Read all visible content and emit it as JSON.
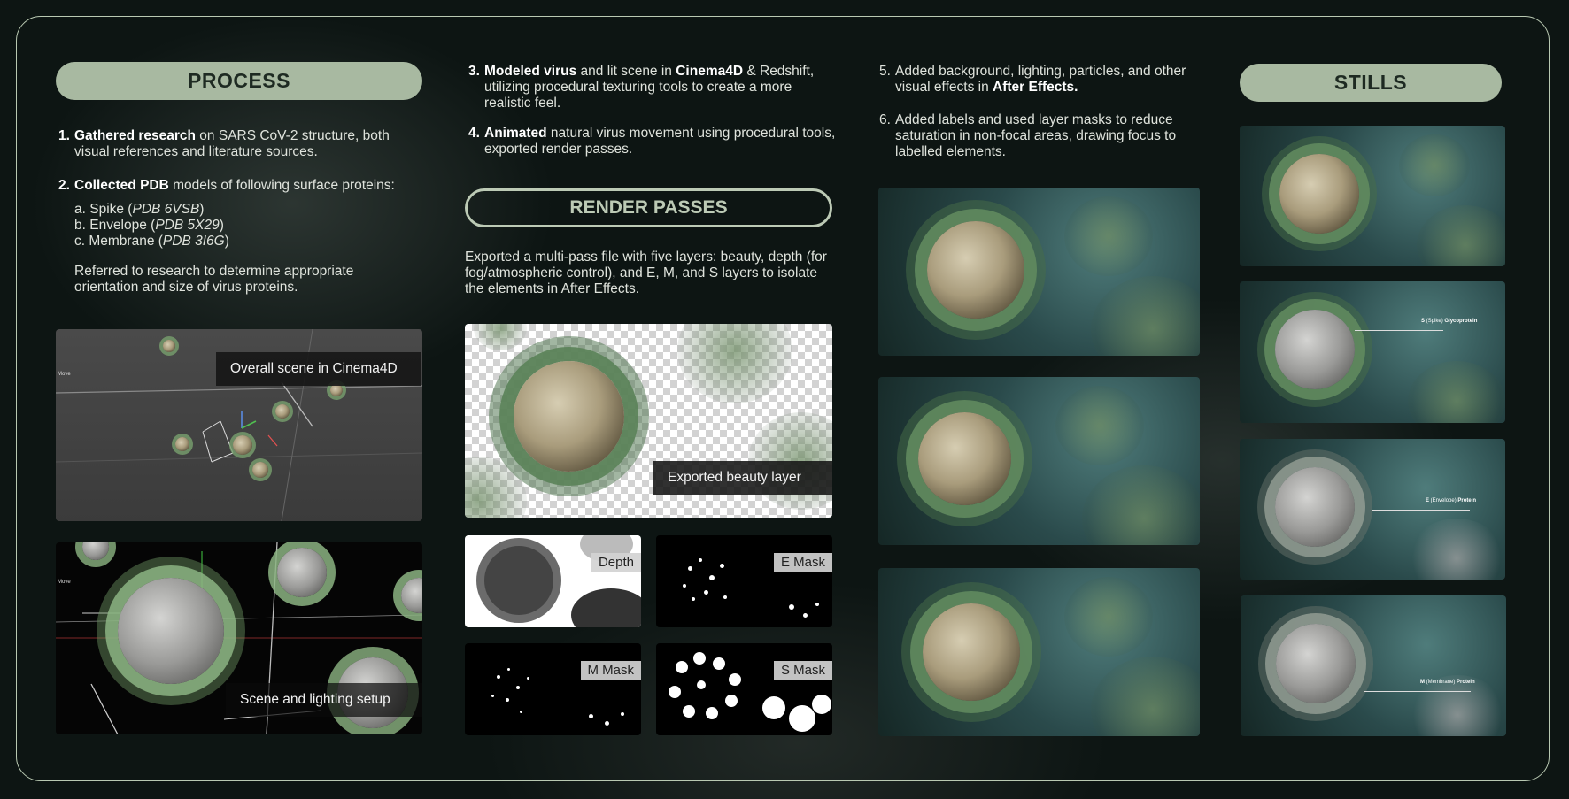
{
  "process": {
    "title": "PROCESS",
    "step1": {
      "num": "1.",
      "bold": "Gathered research",
      "text": " on SARS CoV-2 structure, both visual references and literature sources."
    },
    "step2": {
      "num": "2.",
      "bold": "Collected PDB",
      "text": " models of following surface proteins:"
    },
    "proteins": [
      {
        "prefix": "a. Spike (",
        "code": "PDB 6VSB",
        "suffix": ")"
      },
      {
        "prefix": "b. Envelope (",
        "code": "PDB 5X29",
        "suffix": ")"
      },
      {
        "prefix": "c. Membrane (",
        "code": "PDB 3I6G",
        "suffix": ")"
      }
    ],
    "note": "Referred to research to determine appropriate orientation and size of virus proteins.",
    "caption_scene": "Overall scene in Cinema4D",
    "caption_lighting": "Scene and lighting setup",
    "move_label": "Move"
  },
  "steps_mid": {
    "step3": {
      "num": "3.",
      "bold": "Modeled virus",
      "t1": " and lit scene in ",
      "bold2": "Cinema4D",
      "t2": " & Redshift, utilizing procedural texturing tools to create a more realistic feel."
    },
    "step4": {
      "num": "4.",
      "bold": "Animated",
      "text": " natural virus movement using procedural tools, exported render passes."
    }
  },
  "render_passes": {
    "title": "RENDER PASSES",
    "desc": "Exported a multi-pass file with five layers: beauty, depth (for fog/atmospheric control), and E, M, and S layers to isolate the elements in After Effects.",
    "caption_beauty": "Exported beauty layer",
    "labels": {
      "depth": "Depth",
      "e_mask": "E Mask",
      "m_mask": "M Mask",
      "s_mask": "S Mask"
    }
  },
  "steps_right": {
    "step5": {
      "num": "5.",
      "text": "Added background, lighting, particles, and other visual effects in ",
      "bold": "After Effects."
    },
    "step6": {
      "num": "6.",
      "text": "Added labels and used layer masks to reduce saturation in non-focal areas, drawing focus to labelled elements."
    }
  },
  "stills": {
    "title": "STILLS",
    "labels": [
      {
        "bold": "S",
        "mid": " (Spike) ",
        "bold2": "Glycoprotein"
      },
      {
        "bold": "E",
        "mid": " (Envelope) ",
        "bold2": "Protein"
      },
      {
        "bold": "M",
        "mid": " (Membrane) ",
        "bold2": "Protein"
      }
    ]
  },
  "colors": {
    "accent": "#a8b9a1",
    "frame": "#b9c9b2",
    "background": "#0d1513"
  }
}
